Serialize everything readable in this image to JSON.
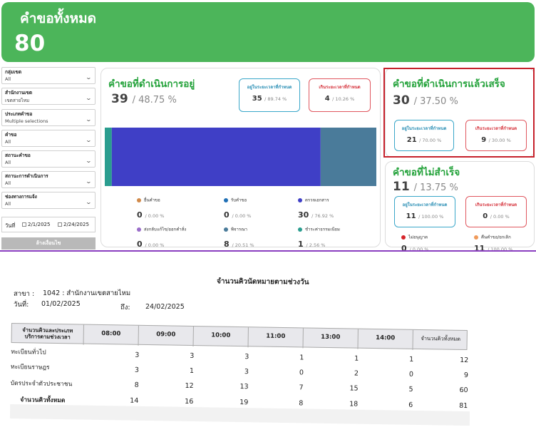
{
  "header": {
    "title": "คำขอทั้งหมด",
    "total": "80",
    "color": "#4cb55a"
  },
  "filters": [
    {
      "label": "กลุ่มเขต",
      "value": "All"
    },
    {
      "label": "สำนักงานเขต",
      "value": "เขตสายไหม"
    },
    {
      "label": "ประเภทคำขอ",
      "value": "Multiple selections"
    },
    {
      "label": "คำขอ",
      "value": "All"
    },
    {
      "label": "สถานะคำขอ",
      "value": "All"
    },
    {
      "label": "สถานะการดำเนินการ",
      "value": "All"
    },
    {
      "label": "ช่องทางการแจ้ง",
      "value": "All"
    }
  ],
  "date_filter": {
    "label": "วันที่",
    "from": "2/1/2025",
    "to": "2/24/2025"
  },
  "clear_button": "ล้างเงื่อนไข",
  "in_progress": {
    "title": "คำขอที่ดำเนินการอยู่",
    "count": "39",
    "percent": "/ 48.75 %",
    "within": {
      "label": "อยู่ในระยะเวลาที่กำหนด",
      "count": "35",
      "percent": "/ 89.74 %"
    },
    "over": {
      "label": "เกินระยะเวลาที่กำหนด",
      "count": "4",
      "percent": "/ 10.26 %"
    },
    "bar_segments": [
      {
        "name": "ยื่นคำขอ",
        "value": 0,
        "color": "#d18a4a"
      },
      {
        "name": "รับคำขอ",
        "value": 0,
        "color": "#1f6fb5"
      },
      {
        "name": "ส่งกลับแก้ไข/ออกคำสั่ง",
        "value": 0,
        "color": "#9a6dc9"
      },
      {
        "name": "ชำระค่าธรรมเนียม",
        "value": 1,
        "color": "#2a9d8f"
      },
      {
        "name": "ตรวจเอกสาร",
        "value": 30,
        "color": "#3f3fc6"
      },
      {
        "name": "พิจารณา",
        "value": 8,
        "color": "#4a7b9a"
      }
    ],
    "legend": [
      {
        "label": "ยื่นคำขอ",
        "count": "0",
        "percent": "/ 0.00 %",
        "color": "#d18a4a"
      },
      {
        "label": "รับคำขอ",
        "count": "0",
        "percent": "/ 0.00 %",
        "color": "#1f6fb5"
      },
      {
        "label": "ตรวจเอกสาร",
        "count": "30",
        "percent": "/ 76.92 %",
        "color": "#3f3fc6"
      },
      {
        "label": "ส่งกลับแก้ไข/ออกคำสั่ง",
        "count": "0",
        "percent": "/ 0.00 %",
        "color": "#9a6dc9"
      },
      {
        "label": "พิจารณา",
        "count": "8",
        "percent": "/ 20.51 %",
        "color": "#4a7b9a"
      },
      {
        "label": "ชำระค่าธรรมเนียม",
        "count": "1",
        "percent": "/ 2.56 %",
        "color": "#2a9d8f"
      }
    ]
  },
  "completed": {
    "title": "คำขอที่ดำเนินการแล้วเสร็จ",
    "count": "30",
    "percent": "/ 37.50 %",
    "within": {
      "label": "อยู่ในระยะเวลาที่กำหนด",
      "count": "21",
      "percent": "/ 70.00 %"
    },
    "over": {
      "label": "เกินระยะเวลาที่กำหนด",
      "count": "9",
      "percent": "/ 30.00 %"
    }
  },
  "failed": {
    "title": "คำขอที่ไม่สำเร็จ",
    "count": "11",
    "percent": "/ 13.75 %",
    "within": {
      "label": "อยู่ในระยะเวลาที่กำหนด",
      "count": "11",
      "percent": "/ 100.00 %"
    },
    "over": {
      "label": "เกินระยะเวลาที่กำหนด",
      "count": "0",
      "percent": "/ 0.00 %"
    },
    "legend": [
      {
        "label": "ไม่อนุญาต",
        "count": "0",
        "percent": "/ 0.00 %",
        "color": "#d6242a"
      },
      {
        "label": "คืนคำขอ/ยกเลิก",
        "count": "11",
        "percent": "/ 100.00 %",
        "color": "#f09a5a"
      }
    ]
  },
  "report": {
    "title": "จำนวนคิวนัดหมายตามช่วงวัน",
    "branch_label": "สาขา :",
    "branch_value": "1042 : สำนักงานเขตสายไหม",
    "date_label": "วันที่:",
    "date_from": "01/02/2025",
    "to_label": "ถึง:",
    "date_to": "24/02/2025",
    "columns": [
      "08:00",
      "09:00",
      "10:00",
      "11:00",
      "13:00",
      "14:00"
    ],
    "first_col_header": [
      "จำนวนคิวและประเภท",
      "บริการตามช่วงเวลา"
    ],
    "last_col_header": "จำนวนคิวทั้งหมด",
    "rows": [
      {
        "label": "ทะเบียนทั่วไป",
        "values": [
          "3",
          "3",
          "3",
          "1",
          "1",
          "1"
        ],
        "total": "12"
      },
      {
        "label": "ทะเบียนราษฎร",
        "values": [
          "3",
          "1",
          "3",
          "0",
          "2",
          "0"
        ],
        "total": "9"
      },
      {
        "label": "บัตรประจำตัวประชาชน",
        "values": [
          "8",
          "12",
          "13",
          "7",
          "15",
          "5"
        ],
        "total": "60"
      }
    ],
    "total_row": {
      "label": "จำนวนคิวทั้งหมด",
      "values": [
        "14",
        "16",
        "19",
        "8",
        "18",
        "6"
      ],
      "total": "81"
    }
  }
}
